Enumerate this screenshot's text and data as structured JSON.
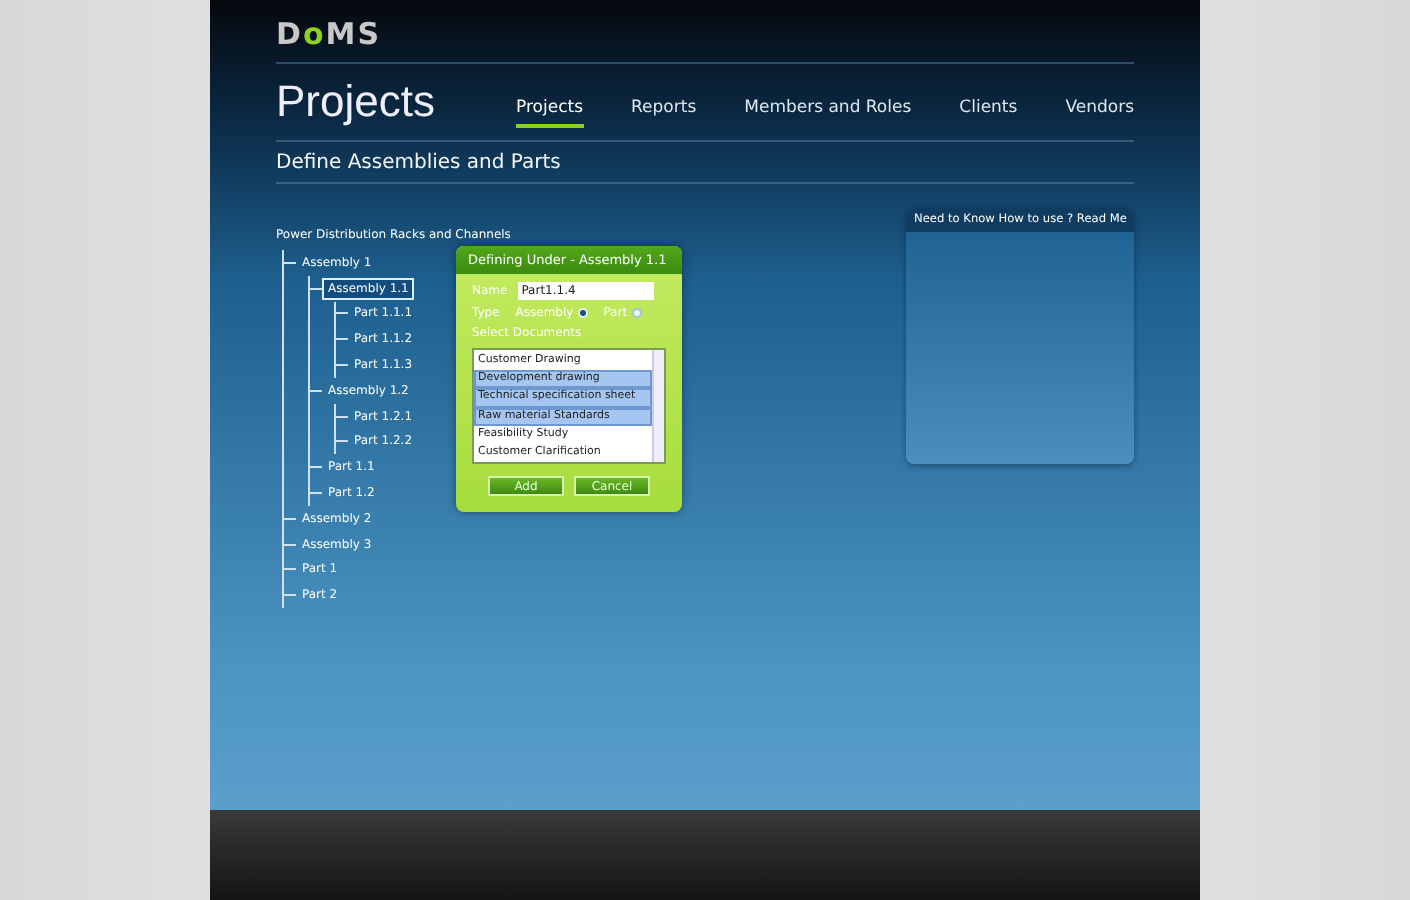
{
  "logo": {
    "lead": "D",
    "accent": "o",
    "tail": "MS"
  },
  "page_title": "Projects",
  "nav": [
    {
      "label": "Projects",
      "selected": true
    },
    {
      "label": "Reports",
      "selected": false
    },
    {
      "label": "Members and Roles",
      "selected": false
    },
    {
      "label": "Clients",
      "selected": false
    },
    {
      "label": "Vendors",
      "selected": false
    }
  ],
  "section_title": "Define Assemblies and Parts",
  "tree": {
    "root": "Power Distribution Racks and Channels",
    "children": [
      {
        "label": "Assembly 1",
        "selected": false,
        "children": [
          {
            "label": "Assembly 1.1",
            "selected": true,
            "children": [
              {
                "label": "Part 1.1.1",
                "selected": false
              },
              {
                "label": "Part 1.1.2",
                "selected": false
              },
              {
                "label": "Part 1.1.3",
                "selected": false
              }
            ]
          },
          {
            "label": "Assembly 1.2",
            "selected": false,
            "children": [
              {
                "label": "Part 1.2.1",
                "selected": false
              },
              {
                "label": "Part 1.2.2",
                "selected": false
              }
            ]
          },
          {
            "label": "Part 1.1",
            "selected": false
          },
          {
            "label": "Part 1.2",
            "selected": false
          }
        ]
      },
      {
        "label": "Assembly 2",
        "selected": false
      },
      {
        "label": "Assembly 3",
        "selected": false
      },
      {
        "label": "Part 1",
        "selected": false
      },
      {
        "label": "Part 2",
        "selected": false
      }
    ]
  },
  "dialog": {
    "title": "Defining Under - Assembly 1.1",
    "name_label": "Name",
    "name_value": "Part1.1.4",
    "type_label": "Type",
    "type_options": [
      {
        "label": "Assembly",
        "selected": true
      },
      {
        "label": "Part",
        "selected": false
      }
    ],
    "documents_label": "Select Documents",
    "documents": [
      {
        "label": "Customer Drawing",
        "selected": false
      },
      {
        "label": "Development drawing",
        "selected": true
      },
      {
        "label": "Technical specification sheet",
        "selected": true
      },
      {
        "label": "Raw material Standards",
        "selected": true
      },
      {
        "label": "Feasibility Study",
        "selected": false
      },
      {
        "label": "Customer Clarification",
        "selected": false
      }
    ],
    "buttons": [
      "Add",
      "Cancel"
    ]
  },
  "help_panel": {
    "title": "Need to Know How to use ? Read Me"
  }
}
